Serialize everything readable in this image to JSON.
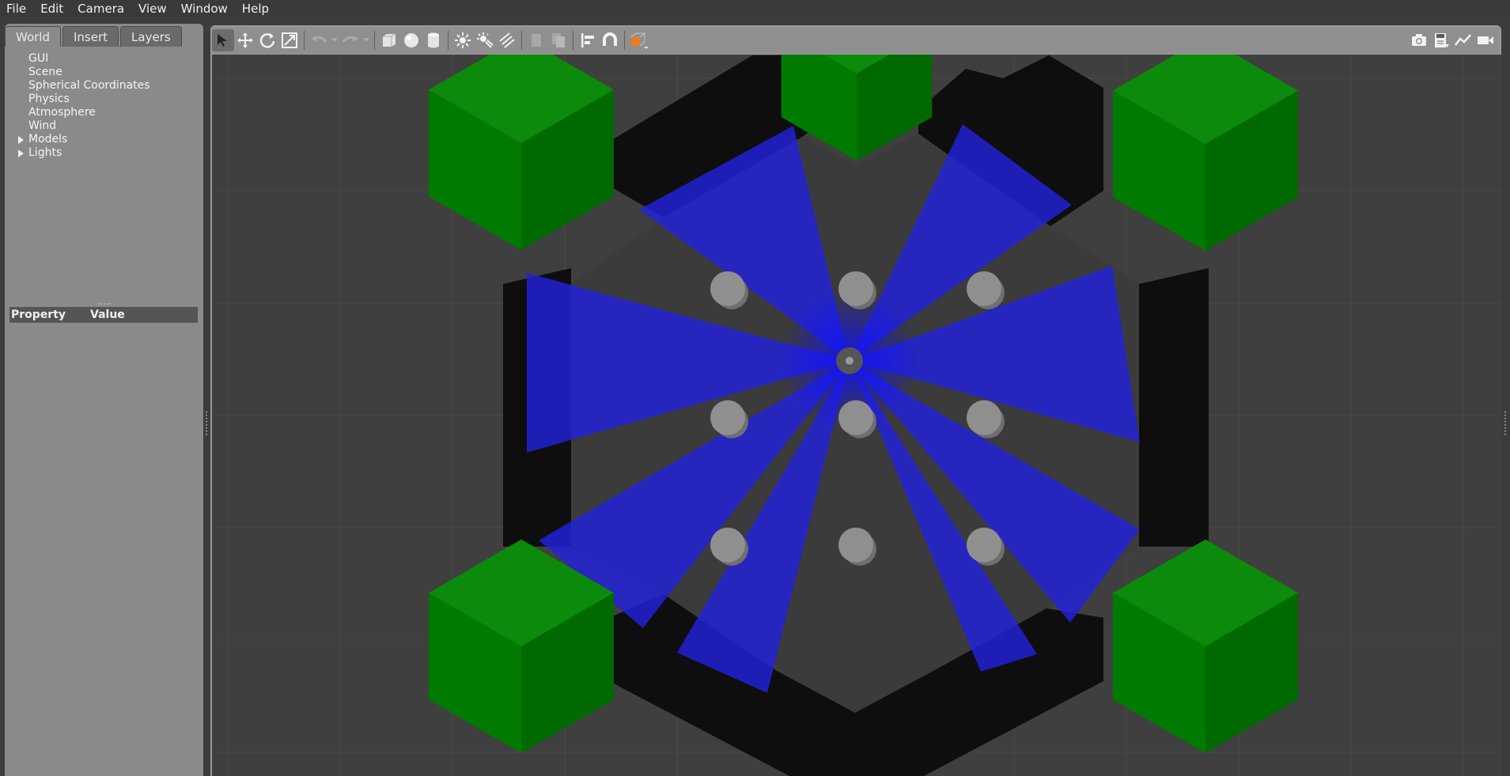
{
  "menu": [
    "File",
    "Edit",
    "Camera",
    "View",
    "Window",
    "Help"
  ],
  "tabs": [
    "World",
    "Insert",
    "Layers"
  ],
  "tree": [
    {
      "label": "GUI",
      "expandable": false
    },
    {
      "label": "Scene",
      "expandable": false
    },
    {
      "label": "Spherical Coordinates",
      "expandable": false
    },
    {
      "label": "Physics",
      "expandable": false
    },
    {
      "label": "Atmosphere",
      "expandable": false
    },
    {
      "label": "Wind",
      "expandable": false
    },
    {
      "label": "Models",
      "expandable": true
    },
    {
      "label": "Lights",
      "expandable": true
    }
  ],
  "properties": {
    "col_property": "Property",
    "col_value": "Value"
  },
  "toolbar": {
    "tools": [
      "select-arrow-icon",
      "translate-icon",
      "rotate-icon",
      "scale-icon",
      "undo-icon",
      "redo-icon",
      "box-shape-icon",
      "sphere-shape-icon",
      "cylinder-shape-icon",
      "point-light-icon",
      "spot-light-icon",
      "directional-light-icon",
      "copy-icon",
      "paste-icon",
      "align-icon",
      "snap-magnet-icon",
      "view-angle-icon"
    ],
    "right_tools": [
      "screenshot-icon",
      "log-icon",
      "plot-icon",
      "video-record-icon"
    ]
  },
  "colors": {
    "laser": "#2222dd",
    "cube": "#007a00",
    "wall": "#0e0e0e",
    "pillar": "#8f8f8f",
    "ground": "#3f3f3f",
    "grid": "#4a4a4a"
  }
}
